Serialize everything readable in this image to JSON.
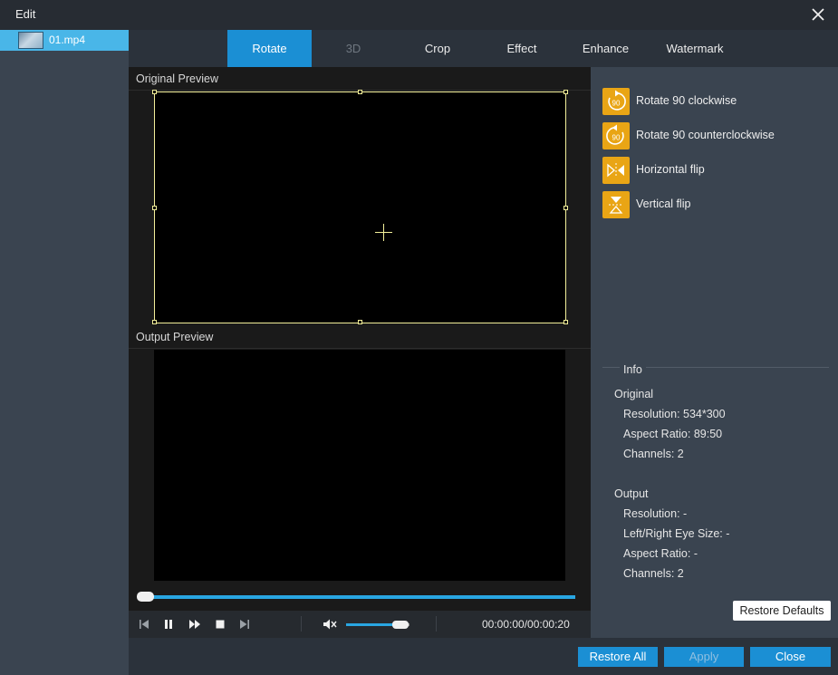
{
  "window": {
    "title": "Edit"
  },
  "sidebar": {
    "files": [
      {
        "name": "01.mp4"
      }
    ]
  },
  "tabs": [
    "Rotate",
    "3D",
    "Crop",
    "Effect",
    "Enhance",
    "Watermark"
  ],
  "preview": {
    "original_label": "Original Preview",
    "output_label": "Output Preview",
    "progress": 0.0,
    "volume": 0.85,
    "timecode": "00:00:00/00:00:20"
  },
  "rotate_actions": [
    {
      "label": "Rotate 90 clockwise",
      "icon": "rotate-cw-icon"
    },
    {
      "label": "Rotate 90 counterclockwise",
      "icon": "rotate-ccw-icon"
    },
    {
      "label": "Horizontal flip",
      "icon": "horizontal-flip-icon"
    },
    {
      "label": "Vertical flip",
      "icon": "vertical-flip-icon"
    }
  ],
  "rotate_icon_text": "90",
  "info": {
    "title": "Info",
    "original": {
      "heading": "Original",
      "resolution": "Resolution: 534*300",
      "aspect_ratio": "Aspect Ratio: 89:50",
      "channels": "Channels: 2"
    },
    "output": {
      "heading": "Output",
      "resolution": "Resolution: -",
      "eye_size": "Left/Right Eye Size: -",
      "aspect_ratio": "Aspect Ratio: -",
      "channels": "Channels: 2"
    }
  },
  "buttons": {
    "restore_defaults": "Restore Defaults",
    "restore_all": "Restore All",
    "apply": "Apply",
    "close": "Close"
  },
  "colors": {
    "accent": "#1b8fd4",
    "icon_bg": "#e9a515",
    "crop_frame": "#f3ef9a",
    "selected_file": "#49b6e8"
  }
}
